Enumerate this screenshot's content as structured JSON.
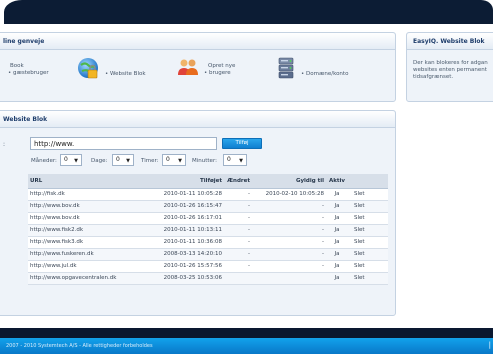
{
  "shortcuts": {
    "title": "line genveje",
    "items": [
      {
        "label_line1": "Book",
        "label_line2": "• gæstebruger"
      },
      {
        "label": "• Website Blok"
      },
      {
        "label_line1": "Opret nye",
        "label_line2": "• brugere"
      },
      {
        "label": "• Domæne/konto"
      }
    ]
  },
  "easyiq": {
    "title": "EasyIQ. Website Blok",
    "text_lines": [
      "Der kan blokeres for adgan",
      "websites enten permanent",
      "tidsafgrænset."
    ]
  },
  "block": {
    "title": "Website Blok",
    "url_value": "http://www.",
    "submit_label": "Tilføj",
    "months_label": "Måneder:",
    "months_value": "0",
    "days_label": "Dage:",
    "days_value": "0",
    "hours_label": "Timer:",
    "hours_value": "0",
    "minutes_label": "Minutter:",
    "minutes_value": "0"
  },
  "table": {
    "headers": {
      "url": "URL",
      "added": "Tilføjet",
      "changed": "Ændret",
      "valid": "Gyldig til",
      "active": "Aktiv"
    },
    "rows": [
      {
        "url": "http://fisk.dk",
        "added": "2010-01-11 10:05:28",
        "changed": "-",
        "valid": "2010-02-10 10:05:28",
        "active": "Ja",
        "action": "Slet"
      },
      {
        "url": "http://www.bov.dk",
        "added": "2010-01-26 16:15:47",
        "changed": "-",
        "valid": "-",
        "active": "Ja",
        "action": "Slet"
      },
      {
        "url": "http://www.bov.dk",
        "added": "2010-01-26 16:17:01",
        "changed": "-",
        "valid": "-",
        "active": "Ja",
        "action": "Slet"
      },
      {
        "url": "http://www.fisk2.dk",
        "added": "2010-01-11 10:13:11",
        "changed": "-",
        "valid": "-",
        "active": "Ja",
        "action": "Slet"
      },
      {
        "url": "http://www.fisk3.dk",
        "added": "2010-01-11 10:36:08",
        "changed": "-",
        "valid": "-",
        "active": "Ja",
        "action": "Slet"
      },
      {
        "url": "http://www.fuskeren.dk",
        "added": "2008-03-13 14:20:10",
        "changed": "-",
        "valid": "-",
        "active": "Ja",
        "action": "Slet"
      },
      {
        "url": "http://www.jul.dk",
        "added": "2010-01-26 15:57:56",
        "changed": "-",
        "valid": "-",
        "active": "Ja",
        "action": "Slet"
      },
      {
        "url": "http://www.opgavecentralen.dk",
        "added": "2008-03-25 10:53:06",
        "changed": "",
        "valid": "",
        "active": "Ja",
        "action": "Slet"
      }
    ]
  },
  "footer": {
    "text": "2007 - 2010 Systemtech A/S - Alle rettigheder forbeholdes",
    "mark": "|"
  },
  "colors": {
    "accent": "#0f7fd0",
    "header_dark": "#0c1c34"
  }
}
